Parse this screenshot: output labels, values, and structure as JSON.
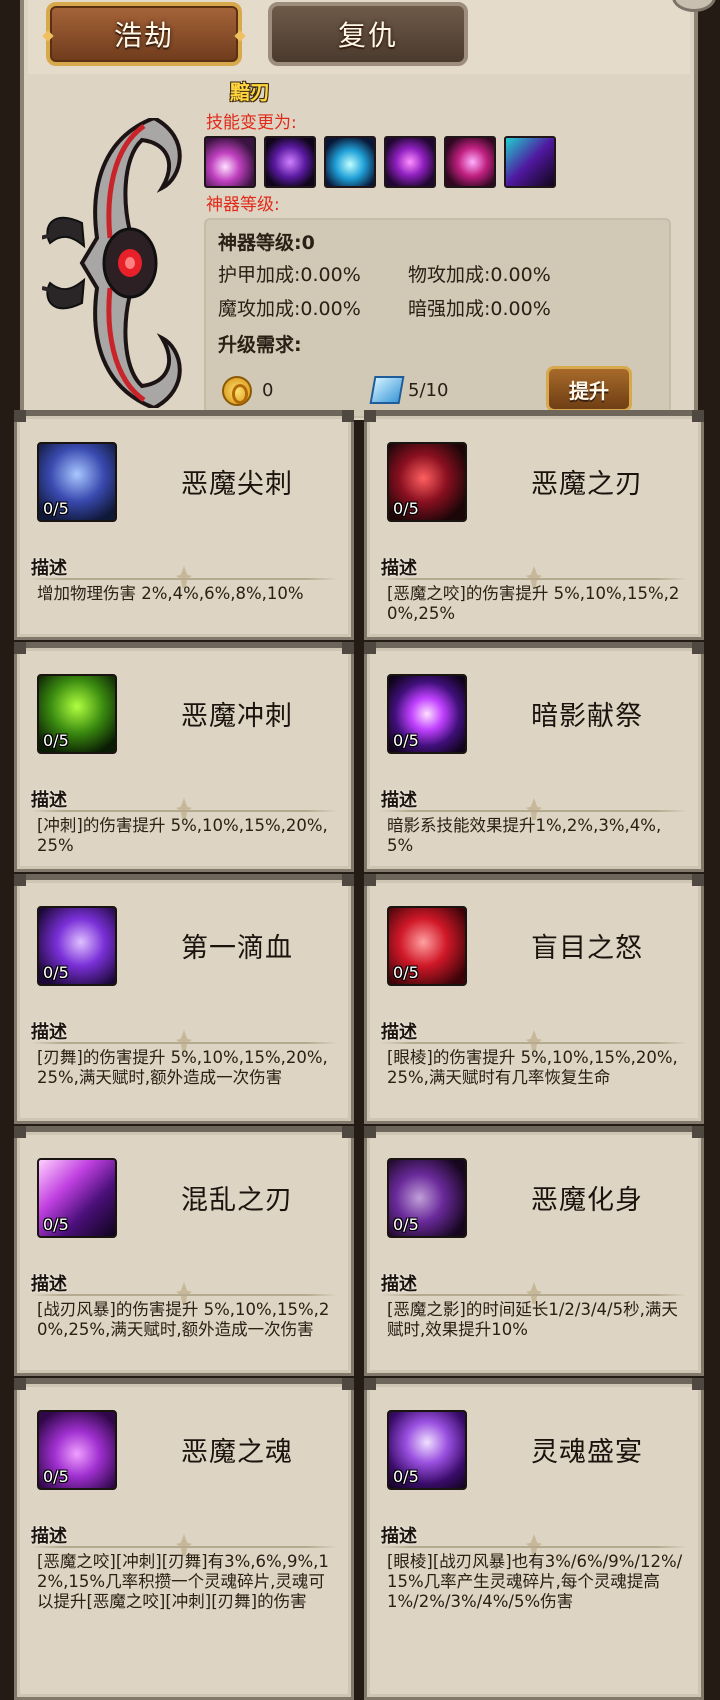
{
  "tabs": [
    {
      "label": "浩劫",
      "active": true
    },
    {
      "label": "复仇",
      "active": false
    }
  ],
  "weapon": {
    "name": "黯刃",
    "skill_change_label": "技能变更为:",
    "artifact_level_label": "神器等级:",
    "skill_icons": [
      "slash-icon",
      "shadow-strike-icon",
      "cyan-wave-icon",
      "purple-ring-icon",
      "pink-vortex-icon",
      "void-flame-icon"
    ]
  },
  "stats": {
    "level_line": "神器等级:0",
    "armor": "护甲加成:0.00%",
    "phys_atk": "物攻加成:0.00%",
    "magic_atk": "魔攻加成:0.00%",
    "dark_str": "暗强加成:0.00%",
    "upgrade_req_label": "升级需求:",
    "gold": "0",
    "crystal": "5/10",
    "upgrade_button": "提升"
  },
  "cards": [
    {
      "title": "恶魔尖刺",
      "level": "0/5",
      "desc_label": "描述",
      "desc": "增加物理伤害 2%,4%,6%,8%,10%",
      "icon": "spike-icon"
    },
    {
      "title": "恶魔之刃",
      "level": "0/5",
      "desc_label": "描述",
      "desc": "[恶魔之咬]的伤害提升 5%,10%,15%,20%,25%",
      "icon": "blade-icon"
    },
    {
      "title": "恶魔冲刺",
      "level": "0/5",
      "desc_label": "描述",
      "desc": "[冲刺]的伤害提升 5%,10%,15%,20%,25%",
      "icon": "dash-icon"
    },
    {
      "title": "暗影献祭",
      "level": "0/5",
      "desc_label": "描述",
      "desc": "暗影系技能效果提升1%,2%,3%,4%,5%",
      "icon": "sacrifice-icon"
    },
    {
      "title": "第一滴血",
      "level": "0/5",
      "desc_label": "描述",
      "desc": "[刃舞]的伤害提升 5%,10%,15%,20%,25%,满天赋时,额外造成一次伤害",
      "icon": "first-blood-icon"
    },
    {
      "title": "盲目之怒",
      "level": "0/5",
      "desc_label": "描述",
      "desc": "[眼棱]的伤害提升 5%,10%,15%,20%,25%,满天赋时有几率恢复生命",
      "icon": "blind-rage-icon"
    },
    {
      "title": "混乱之刃",
      "level": "0/5",
      "desc_label": "描述",
      "desc": "[战刃风暴]的伤害提升 5%,10%,15%,20%,25%,满天赋时,额外造成一次伤害",
      "icon": "chaos-blade-icon"
    },
    {
      "title": "恶魔化身",
      "level": "0/5",
      "desc_label": "描述",
      "desc": "[恶魔之影]的时间延长1/2/3/4/5秒,满天赋时,效果提升10%",
      "icon": "demon-form-icon"
    },
    {
      "title": "恶魔之魂",
      "level": "0/5",
      "desc_label": "描述",
      "desc": "[恶魔之咬][冲刺][刃舞]有3%,6%,9%,12%,15%几率积攒一个灵魂碎片,灵魂可以提升[恶魔之咬][冲刺][刃舞]的伤害",
      "icon": "demon-soul-icon"
    },
    {
      "title": "灵魂盛宴",
      "level": "0/5",
      "desc_label": "描述",
      "desc": "[眼棱][战刃风暴]也有3%/6%/9%/12%/15%几率产生灵魂碎片,每个灵魂提高1%/2%/3%/4%/5%伤害",
      "icon": "soul-feast-icon"
    }
  ]
}
